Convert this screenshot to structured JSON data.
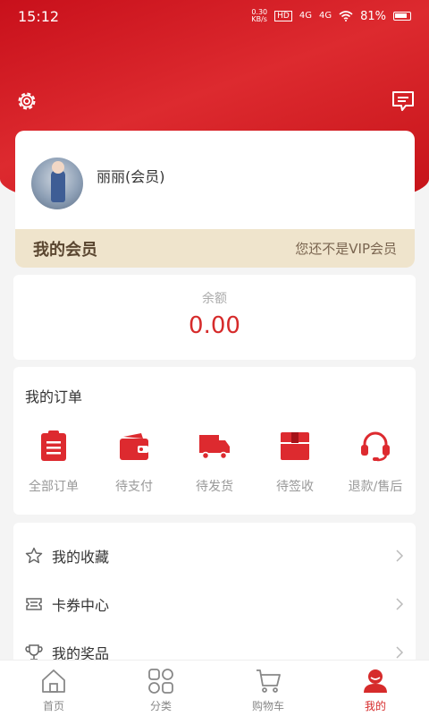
{
  "status_bar": {
    "time": "15:12",
    "net_speed": "0.30\nKB/s",
    "signal_1": "4G",
    "signal_2": "4G",
    "battery": "81%"
  },
  "header": {
    "settings_icon": "gear-icon",
    "message_icon": "chat-bubble-icon"
  },
  "profile": {
    "nickname": "丽丽(会员)",
    "vip_title": "我的会员",
    "vip_status": "您还不是VIP会员"
  },
  "balance": {
    "label": "余额",
    "value": "0.00"
  },
  "orders": {
    "title": "我的订单",
    "items": [
      {
        "label": "全部订单",
        "icon": "clipboard-icon"
      },
      {
        "label": "待支付",
        "icon": "wallet-icon"
      },
      {
        "label": "待发货",
        "icon": "truck-icon"
      },
      {
        "label": "待签收",
        "icon": "box-icon"
      },
      {
        "label": "退款/售后",
        "icon": "headset-icon"
      }
    ]
  },
  "menu": {
    "items": [
      {
        "label": "我的收藏",
        "icon": "star-icon"
      },
      {
        "label": "卡券中心",
        "icon": "ticket-icon"
      },
      {
        "label": "我的奖品",
        "icon": "trophy-icon"
      }
    ]
  },
  "tabbar": {
    "items": [
      {
        "label": "首页",
        "icon": "home-icon"
      },
      {
        "label": "分类",
        "icon": "grid-icon"
      },
      {
        "label": "购物车",
        "icon": "cart-icon"
      },
      {
        "label": "我的",
        "icon": "user-icon",
        "active": true
      }
    ]
  },
  "colors": {
    "brand_red": "#d62b2b",
    "vip_bar": "#efe4cc"
  }
}
